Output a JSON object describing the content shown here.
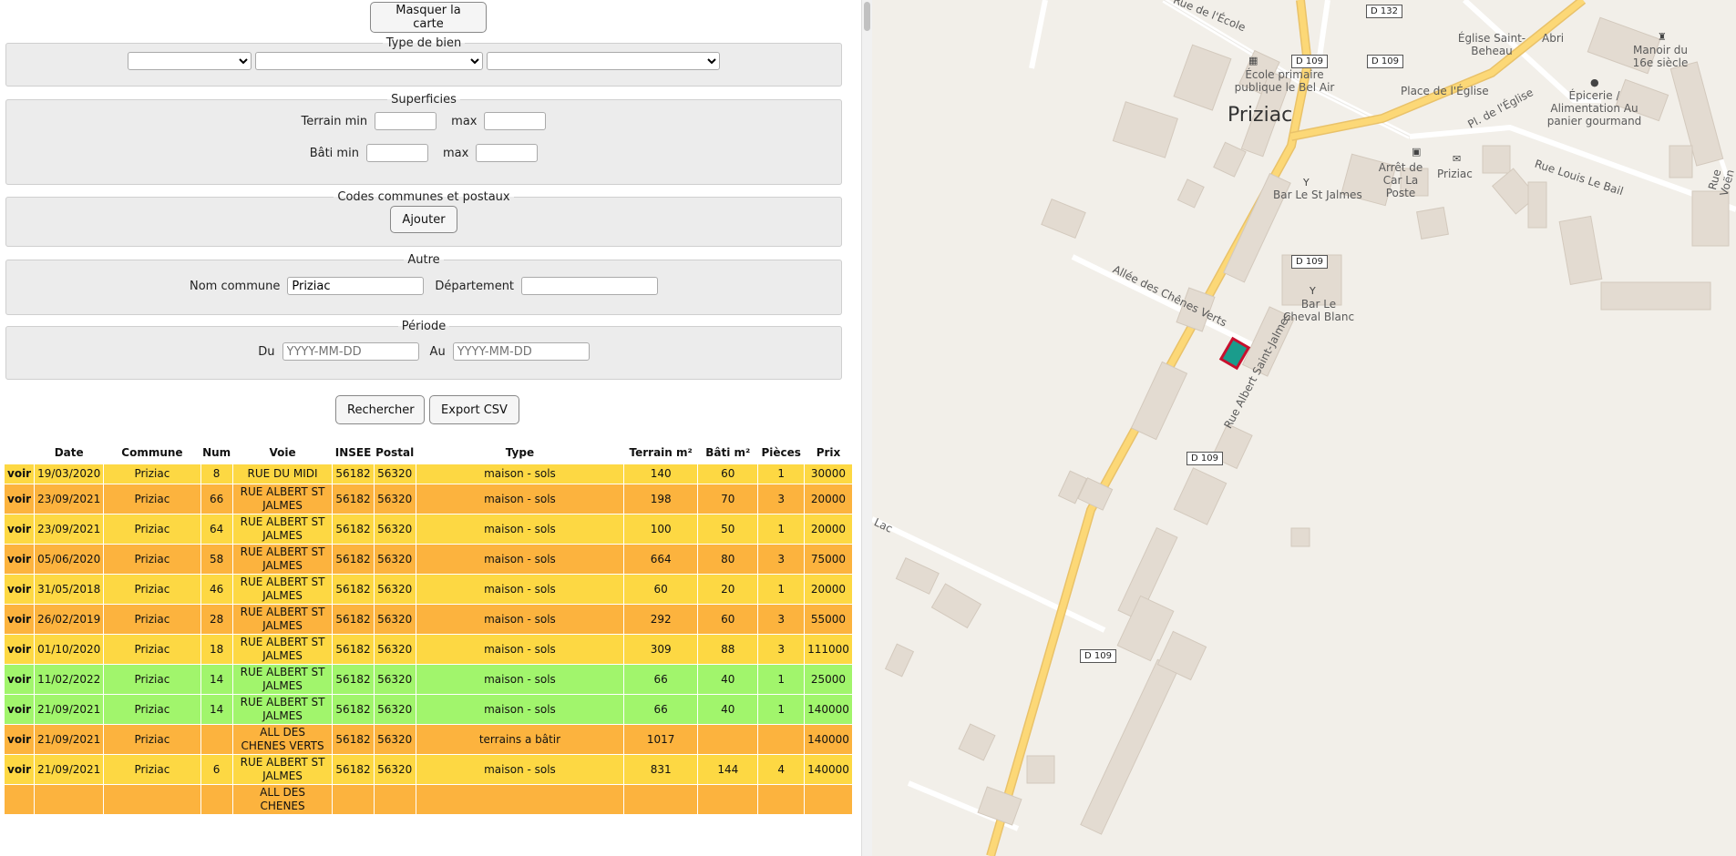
{
  "toggle_map_label": "Masquer la carte",
  "type_de_bien": {
    "legend": "Type de bien",
    "select1": "",
    "select2": "",
    "select3": ""
  },
  "superficies": {
    "legend": "Superficies",
    "terrain_min_label": "Terrain min",
    "terrain_max_label": "max",
    "bati_min_label": "Bâti min",
    "bati_max_label": "max"
  },
  "codes": {
    "legend": "Codes communes et postaux",
    "add_label": "Ajouter"
  },
  "autre": {
    "legend": "Autre",
    "commune_label": "Nom commune",
    "commune_value": "Priziac",
    "departement_label": "Département",
    "departement_value": ""
  },
  "periode": {
    "legend": "Période",
    "du_label": "Du",
    "du_placeholder": "YYYY-MM-DD",
    "au_label": "Au",
    "au_placeholder": "YYYY-MM-DD"
  },
  "actions": {
    "search_label": "Rechercher",
    "export_label": "Export CSV"
  },
  "table": {
    "headers": [
      "",
      "Date",
      "Commune",
      "Num",
      "Voie",
      "INSEE",
      "Postal",
      "Type",
      "Terrain m²",
      "Bâti m²",
      "Pièces",
      "Prix"
    ],
    "rows": [
      {
        "color": "#fdd843",
        "link": "voir",
        "date": "19/03/2020",
        "commune": "Priziac",
        "num": "8",
        "voie": "RUE DU MIDI",
        "insee": "56182",
        "postal": "56320",
        "type": "maison - sols",
        "terrain": "140",
        "bati": "60",
        "pieces": "1",
        "prix": "30000"
      },
      {
        "color": "#fcb33e",
        "link": "voir",
        "date": "23/09/2021",
        "commune": "Priziac",
        "num": "66",
        "voie": "RUE ALBERT ST JALMES",
        "insee": "56182",
        "postal": "56320",
        "type": "maison - sols",
        "terrain": "198",
        "bati": "70",
        "pieces": "3",
        "prix": "20000"
      },
      {
        "color": "#fdd843",
        "link": "voir",
        "date": "23/09/2021",
        "commune": "Priziac",
        "num": "64",
        "voie": "RUE ALBERT ST JALMES",
        "insee": "56182",
        "postal": "56320",
        "type": "maison - sols",
        "terrain": "100",
        "bati": "50",
        "pieces": "1",
        "prix": "20000"
      },
      {
        "color": "#fcb33e",
        "link": "voir",
        "date": "05/06/2020",
        "commune": "Priziac",
        "num": "58",
        "voie": "RUE ALBERT ST JALMES",
        "insee": "56182",
        "postal": "56320",
        "type": "maison - sols",
        "terrain": "664",
        "bati": "80",
        "pieces": "3",
        "prix": "75000"
      },
      {
        "color": "#fdd843",
        "link": "voir",
        "date": "31/05/2018",
        "commune": "Priziac",
        "num": "46",
        "voie": "RUE ALBERT ST JALMES",
        "insee": "56182",
        "postal": "56320",
        "type": "maison - sols",
        "terrain": "60",
        "bati": "20",
        "pieces": "1",
        "prix": "20000"
      },
      {
        "color": "#fcb33e",
        "link": "voir",
        "date": "26/02/2019",
        "commune": "Priziac",
        "num": "28",
        "voie": "RUE ALBERT ST JALMES",
        "insee": "56182",
        "postal": "56320",
        "type": "maison - sols",
        "terrain": "292",
        "bati": "60",
        "pieces": "3",
        "prix": "55000"
      },
      {
        "color": "#fdd843",
        "link": "voir",
        "date": "01/10/2020",
        "commune": "Priziac",
        "num": "18",
        "voie": "RUE ALBERT ST JALMES",
        "insee": "56182",
        "postal": "56320",
        "type": "maison - sols",
        "terrain": "309",
        "bati": "88",
        "pieces": "3",
        "prix": "111000"
      },
      {
        "color": "#a1f56c",
        "link": "voir",
        "date": "11/02/2022",
        "commune": "Priziac",
        "num": "14",
        "voie": "RUE ALBERT ST JALMES",
        "insee": "56182",
        "postal": "56320",
        "type": "maison - sols",
        "terrain": "66",
        "bati": "40",
        "pieces": "1",
        "prix": "25000"
      },
      {
        "color": "#a1f56c",
        "link": "voir",
        "date": "21/09/2021",
        "commune": "Priziac",
        "num": "14",
        "voie": "RUE ALBERT ST JALMES",
        "insee": "56182",
        "postal": "56320",
        "type": "maison - sols",
        "terrain": "66",
        "bati": "40",
        "pieces": "1",
        "prix": "140000"
      },
      {
        "color": "#fcb33e",
        "link": "voir",
        "date": "21/09/2021",
        "commune": "Priziac",
        "num": "",
        "voie": "ALL DES CHENES VERTS",
        "insee": "56182",
        "postal": "56320",
        "type": "terrains a bâtir",
        "terrain": "1017",
        "bati": "",
        "pieces": "",
        "prix": "140000"
      },
      {
        "color": "#fdd843",
        "link": "voir",
        "date": "21/09/2021",
        "commune": "Priziac",
        "num": "6",
        "voie": "RUE ALBERT ST JALMES",
        "insee": "56182",
        "postal": "56320",
        "type": "maison - sols",
        "terrain": "831",
        "bati": "144",
        "pieces": "4",
        "prix": "140000"
      },
      {
        "color": "#fcb33e",
        "link": "",
        "date": "",
        "commune": "",
        "num": "",
        "voie": "ALL DES CHENES",
        "insee": "",
        "postal": "",
        "type": "",
        "terrain": "",
        "bati": "",
        "pieces": "",
        "prix": ""
      }
    ]
  },
  "map": {
    "town": "Priziac",
    "labels": {
      "rue_ecole": "Rue de l'École",
      "d109a": "D 109",
      "d109b": "D 109",
      "d109c": "D 109",
      "d109d": "D 109",
      "d109e": "D 109",
      "d132": "D 132",
      "eglise": "Église Saint-Beheau",
      "abri": "Abri",
      "manoir": "Manoir du 16e siècle",
      "ecole": "École primaire publique le Bel Air",
      "place_eglise": "Place de l'Église",
      "pl_eglise": "Pl. de l'Église",
      "epicerie": "Épicerie / Alimentation Au panier gourmand",
      "arret": "Arrêt de Car La Poste",
      "poste": "Priziac",
      "bar_st_jalmes": "Bar Le St Jalmes",
      "bar_cheval": "Bar Le Cheval Blanc",
      "rue_louis": "Rue Louis Le Bail",
      "rue_voen": "Rue Voën",
      "allee": "Allée des Chênes Verts",
      "rue_albert": "Rue Albert Saint-Jalmes",
      "lac": "Lac"
    }
  }
}
